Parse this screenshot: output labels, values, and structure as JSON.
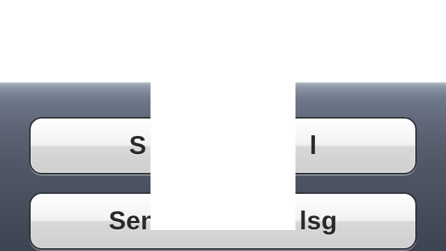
{
  "action_sheet": {
    "buttons": [
      {
        "left_text": "S",
        "right_text": "l"
      },
      {
        "left_text": "Sen",
        "right_text": "lsg"
      }
    ]
  }
}
